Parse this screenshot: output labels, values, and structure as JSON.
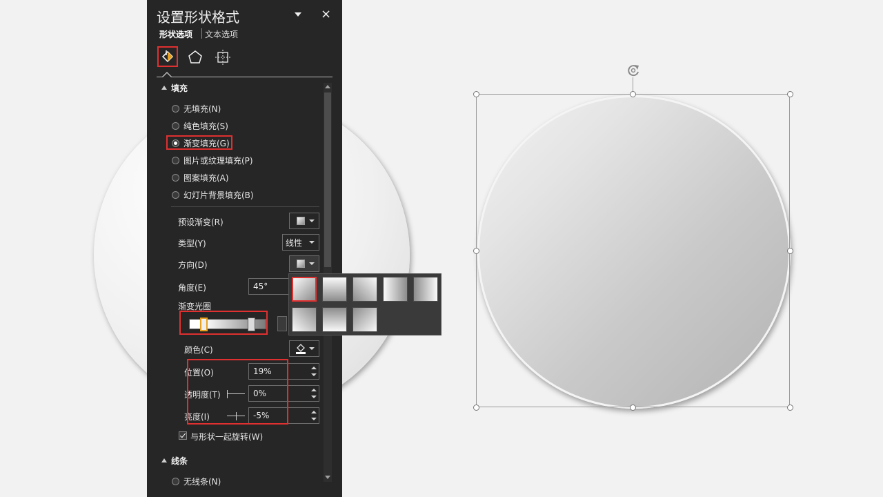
{
  "panel": {
    "title": "设置形状格式",
    "close_glyph": "×",
    "tabs": [
      "形状选项",
      "文本选项"
    ],
    "icons": [
      "fill-line-icon",
      "effects-pentagon-icon",
      "size-properties-icon"
    ]
  },
  "fill_section": {
    "heading": "填充",
    "options": [
      {
        "label": "无填充(N)",
        "selected": false
      },
      {
        "label": "纯色填充(S)",
        "selected": false
      },
      {
        "label": "渐变填充(G)",
        "selected": true
      },
      {
        "label": "图片或纹理填充(P)",
        "selected": false
      },
      {
        "label": "图案填充(A)",
        "selected": false
      },
      {
        "label": "幻灯片背景填充(B)",
        "selected": false
      }
    ],
    "preset_label": "预设渐变(R)",
    "type_label": "类型(Y)",
    "type_value": "线性",
    "direction_label": "方向(D)",
    "angle_label": "角度(E)",
    "angle_value": "45°",
    "stops_label": "渐变光圈",
    "color_label": "颜色(C)",
    "position_label": "位置(O)",
    "position_value": "19%",
    "transparency_label": "透明度(T)",
    "transparency_value": "0%",
    "brightness_label": "亮度(I)",
    "brightness_value": "-5%",
    "rotate_with_shape_label": "与形状一起旋转(W)",
    "rotate_with_shape_checked": true
  },
  "line_section": {
    "heading": "线条",
    "first_option": "无线条(N)"
  },
  "colors": {
    "panel_bg": "#262626",
    "highlight": "#e03030",
    "slide_bg": "#f2f2f2"
  }
}
